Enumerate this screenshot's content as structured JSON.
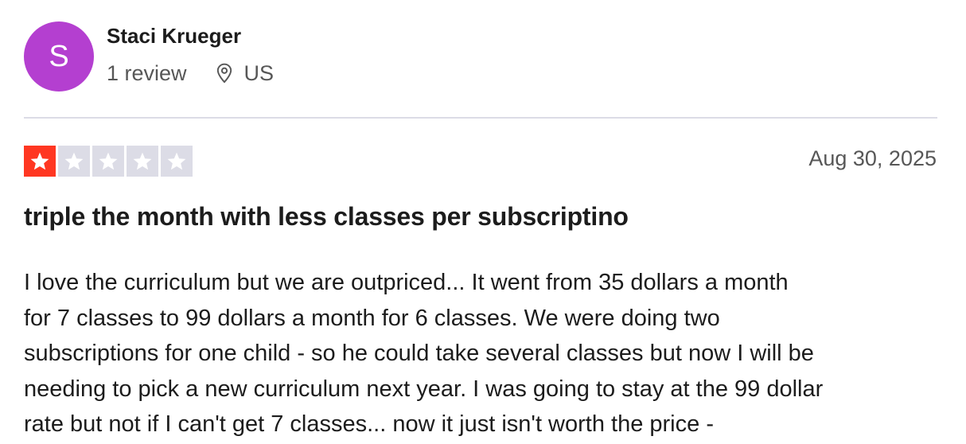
{
  "reviewer": {
    "initial": "S",
    "name": "Staci Krueger",
    "review_count": "1 review",
    "location": "US",
    "avatar_color": "#b43fd0"
  },
  "review": {
    "rating": 1,
    "max_rating": 5,
    "date": "Aug 30, 2025",
    "title": "triple the month with less classes per subscriptino",
    "body_lines": [
      "I love the curriculum but we are outpriced... It went from 35 dollars a month",
      "for 7 classes to 99 dollars a month for 6 classes. We were doing two",
      "subscriptions for one child - so he could take several classes but now I will be",
      "needing to pick a new curriculum next year. I was going to stay at the 99 dollar",
      "rate but not if I can't get 7 classes... now it just isn't worth the price -"
    ]
  },
  "colors": {
    "star_filled": "#ff3722",
    "star_empty": "#dcdce6",
    "divider": "#dcdce6"
  },
  "icons": {
    "location": "location-pin-icon",
    "star": "star-icon"
  }
}
